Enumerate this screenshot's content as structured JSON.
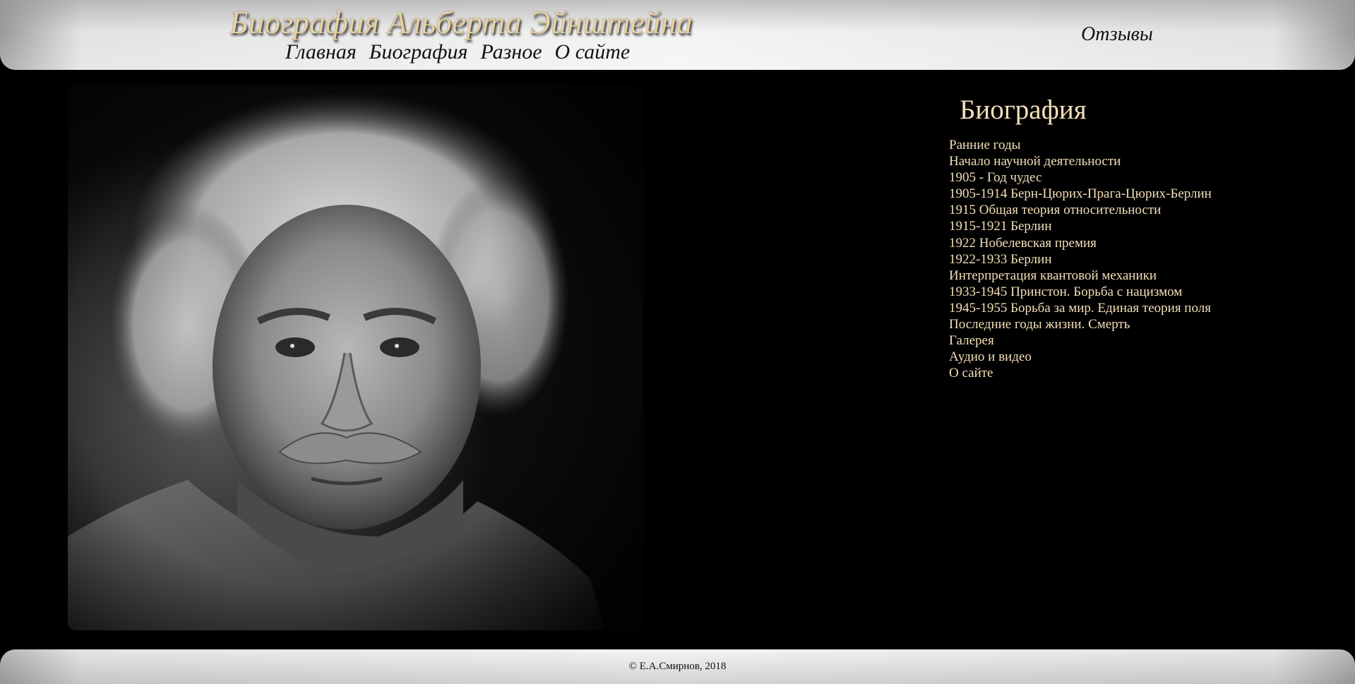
{
  "header": {
    "site_title": "Биография Альберта Эйнштейна",
    "nav": [
      "Главная",
      "Биография",
      "Разное",
      "О сайте"
    ],
    "reviews_label": "Отзывы"
  },
  "sidebar": {
    "title": "Биография",
    "items": [
      "Ранние годы",
      "Начало научной деятельности",
      "1905 - Год чудес",
      "1905-1914 Берн-Цюрих-Прага-Цюрих-Берлин",
      "1915 Общая теория относительности",
      "1915-1921 Берлин",
      "1922 Нобелевская премия",
      "1922-1933 Берлин",
      "Интерпретация квантовой механики",
      "1933-1945 Принстон. Борьба с нацизмом",
      "1945-1955 Борьба за мир. Единая теория поля",
      "Последние годы жизни. Смерть",
      "Галерея",
      "Аудио и видео",
      "О сайте"
    ]
  },
  "portrait": {
    "subject": "black-and-white portrait photo"
  },
  "footer": {
    "copyright": "© Е.А.Смирнов, 2018"
  },
  "colors": {
    "background": "#000000",
    "accent_text": "#f3dfb8",
    "title_text": "#e8d2a6",
    "nav_text": "#111111"
  }
}
